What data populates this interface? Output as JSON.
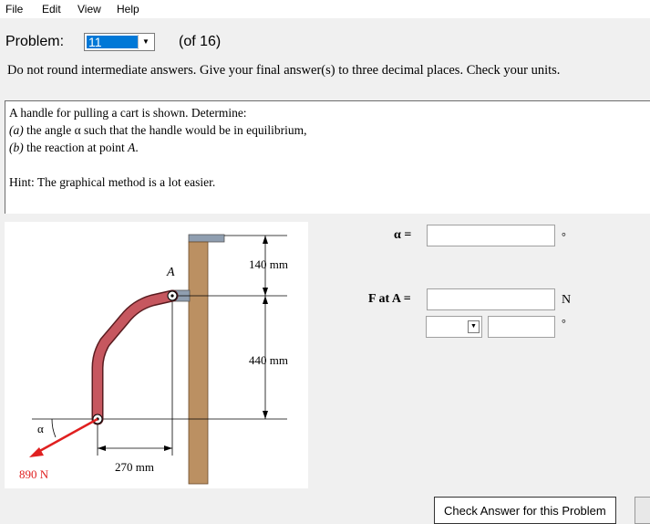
{
  "menu": {
    "file": "File",
    "edit": "Edit",
    "view": "View",
    "help": "Help"
  },
  "problem": {
    "label": "Problem:",
    "selected": "11",
    "of_total": "(of 16)"
  },
  "instructions": "Do not round intermediate answers.  Give your final answer(s) to three decimal places.  Check your units.",
  "statement": {
    "line1": "A handle for pulling a cart is shown.  Determine:",
    "part_a_tag": "(a)",
    "part_a_text": " the angle α such that the handle would be in equilibrium,",
    "part_b_tag": "(b)",
    "part_b_text": " the reaction at point ",
    "part_b_point": "A",
    "part_b_end": ".",
    "hint": "Hint: The graphical method is a lot easier."
  },
  "figure": {
    "dim_top": "140 mm",
    "dim_mid": "440 mm",
    "dim_bottom": "270 mm",
    "point_label": "A",
    "angle_label": "α",
    "force_label": "890 N",
    "colors": {
      "handle": "#c6575f",
      "post": "#bb9062",
      "cap": "#8f9eb0",
      "force": "#e02020"
    }
  },
  "answers": {
    "alpha_label": "α =",
    "alpha_value": "",
    "alpha_unit": "°",
    "force_label": "F at A =",
    "force_value": "",
    "force_unit": "N",
    "dir_selected": "",
    "dir_value": "",
    "dir_unit": "°"
  },
  "check_button": "Check Answer for this Problem"
}
